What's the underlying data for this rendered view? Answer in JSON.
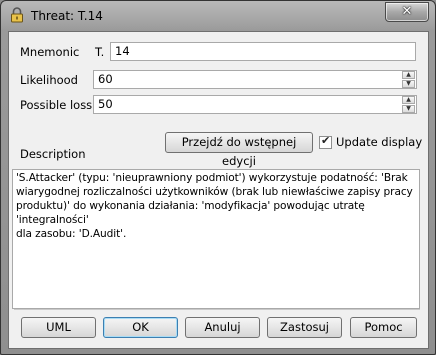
{
  "window": {
    "title": "Threat: T.14"
  },
  "form": {
    "mnemonic_label": "Mnemonic",
    "mnemonic_prefix": "T.",
    "mnemonic_value": "14",
    "likelihood_label": "Likelihood",
    "likelihood_value": "60",
    "possible_loss_label": "Possible loss",
    "possible_loss_value": "50",
    "description_label": "Description",
    "edit_button": "Przejdź do wstępnej edycji",
    "update_display_label": "Update display",
    "update_display_checked": true,
    "description_text": "'S.Attacker' (typu: 'nieuprawniony podmiot') wykorzystuje podatność: 'Brak\nwiarygodnej rozliczalności użytkowników (brak lub niewłaściwe zapisy pracy\nproduktu)' do wykonania działania: 'modyfikacja' powodując utratę 'integralności'\ndla zasobu: 'D.Audit'."
  },
  "buttons": {
    "uml": "UML",
    "ok": "OK",
    "cancel": "Anuluj",
    "apply": "Zastosuj",
    "help": "Pomoc"
  }
}
